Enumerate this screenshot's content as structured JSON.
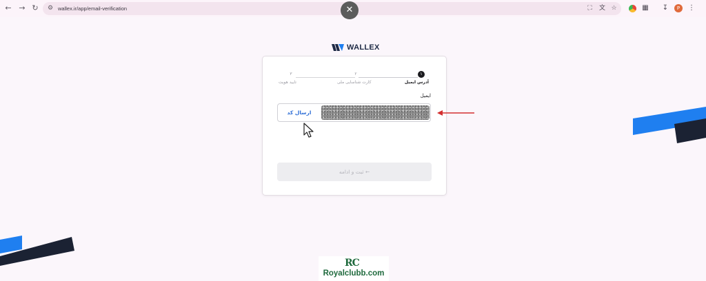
{
  "browser": {
    "url": "wallex.ir/app/email-verification",
    "profile_initial": "P"
  },
  "brand": {
    "name": "WALLEX",
    "text_color": "#1e2a45",
    "accent_blue": "#1f7ff0",
    "dark_navy": "#1b2233"
  },
  "stepper": {
    "steps": [
      {
        "number": "۱",
        "label": "آدرس ایمیل",
        "state": "active"
      },
      {
        "number": "۲",
        "label": "کارت شناسایی ملی",
        "state": "inactive"
      },
      {
        "number": "۳",
        "label": "تایید هویت",
        "state": "inactive"
      }
    ]
  },
  "form": {
    "email_label": "ایمیل",
    "send_code_label": "ارسال کد",
    "submit_label": "ثبت و ادامه"
  },
  "annotation": {
    "arrow_color": "#d32f2f"
  },
  "watermark": {
    "logo": "RC",
    "text": "Royalclubb.com",
    "color": "#1f6a3d"
  }
}
